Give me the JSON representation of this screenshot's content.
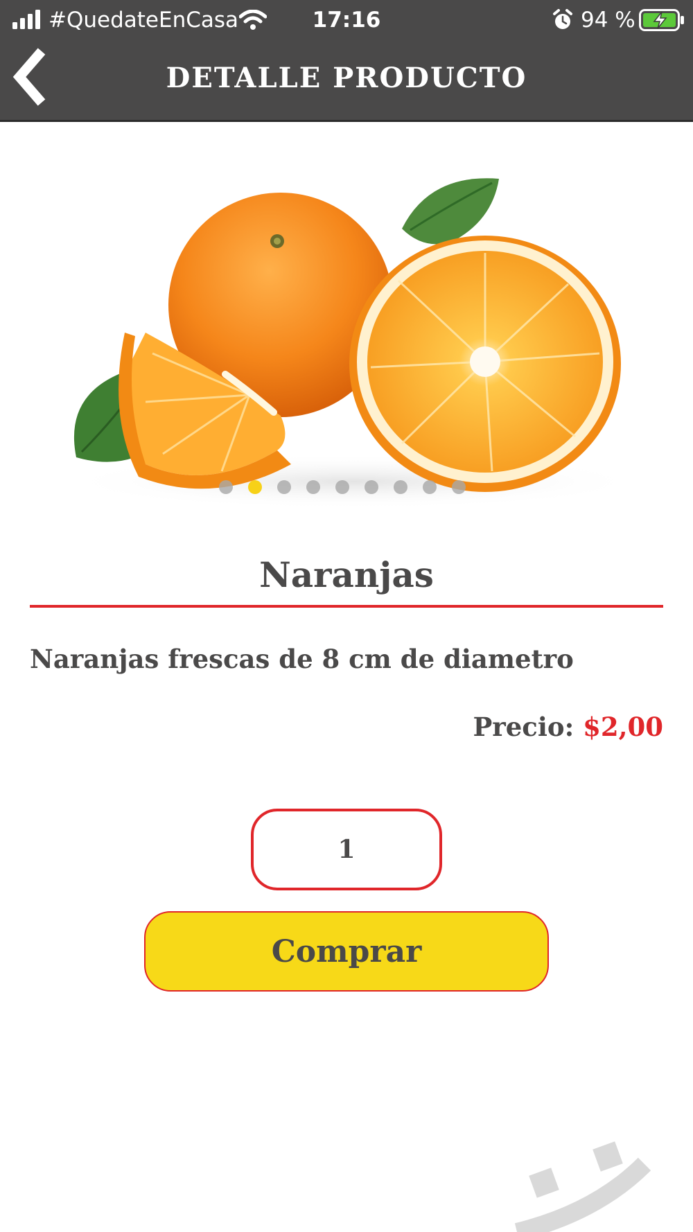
{
  "status_bar": {
    "carrier": "#QuedateEnCasa",
    "time": "17:16",
    "battery_percent": "94 %",
    "icons": [
      "signal-icon",
      "wifi-icon",
      "alarm-icon",
      "battery-charging-icon"
    ]
  },
  "header": {
    "back_icon": "chevron-left-icon",
    "title": "DETALLE PRODUCTO"
  },
  "gallery": {
    "image": "oranges-photo",
    "slide_count": 9,
    "active_index": 1
  },
  "product": {
    "name": "Naranjas",
    "description": "Naranjas frescas de 8 cm de diametro",
    "price_label": "Precio: ",
    "price_value": "$2,00"
  },
  "purchase": {
    "quantity": "1",
    "buy_label": "Comprar"
  },
  "colors": {
    "header_bg": "#4a4949",
    "accent_red": "#e0262a",
    "button_yellow": "#f7d918",
    "text_dark": "#4a4949"
  }
}
